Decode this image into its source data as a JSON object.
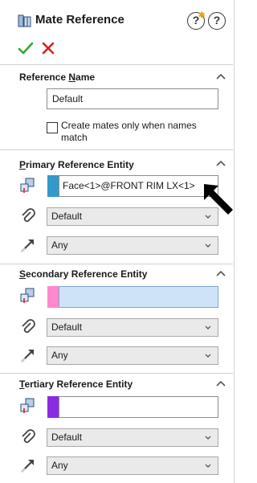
{
  "header": {
    "title": "Mate Reference",
    "help_label": "?",
    "whats_new_label": "?"
  },
  "actions": {
    "ok_icon": "checkmark-icon",
    "cancel_icon": "x-icon"
  },
  "reference_name": {
    "title_pre": "Reference ",
    "title_u": "N",
    "title_post": "ame",
    "value": "Default",
    "checkbox_label": "Create mates only when names match",
    "checkbox_checked": false
  },
  "primary": {
    "title_u": "P",
    "title_post": "rimary Reference Entity",
    "color": "#3399cc",
    "entity": "Face<1>@FRONT RIM LX<1>",
    "mate_type": "Default",
    "alignment": "Any"
  },
  "secondary": {
    "title_u": "S",
    "title_post": "econdary Reference Entity",
    "color": "#ff88cc",
    "entity": "",
    "mate_type": "Default",
    "alignment": "Any"
  },
  "tertiary": {
    "title_u": "T",
    "title_post": "ertiary Reference Entity",
    "color": "#8a2be2",
    "entity": "",
    "mate_type": "Default",
    "alignment": "Any"
  },
  "colors": {
    "ok_green": "#2eaa2e",
    "cancel_red": "#d42020"
  }
}
